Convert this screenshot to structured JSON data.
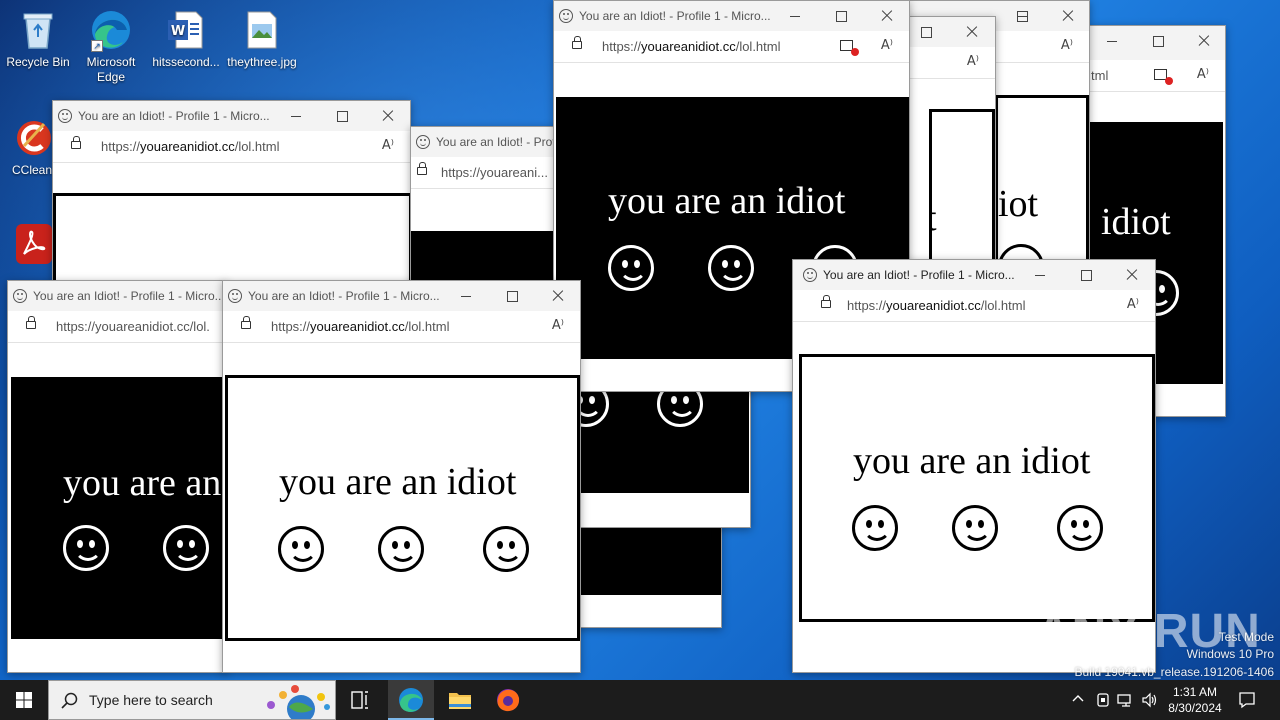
{
  "desktop": {
    "icons": [
      {
        "label": "Recycle Bin",
        "icon": "recycle-bin-icon"
      },
      {
        "label": "Microsoft Edge",
        "icon": "edge-icon"
      },
      {
        "label": "hitssecond...",
        "icon": "word-document-icon"
      },
      {
        "label": "theythree.jpg",
        "icon": "image-file-icon"
      },
      {
        "label": "CClean",
        "icon": "ccleaner-icon"
      },
      {
        "label": "",
        "icon": "acrobat-icon"
      }
    ]
  },
  "browser": {
    "title": "You are an Idiot! - Profile 1 - Micro...",
    "title_short": "You are an Idiot! - Profile",
    "url_prefix": "https://",
    "url_host": "youareanidiot.cc",
    "url_path": "/lol.html",
    "url_full": "https://youareanidiot.cc/lol.html",
    "url_cut_host": "https://youareani...",
    "url_cut_tail": "tml",
    "url_cut_lol": "https://youareanidiot.cc/lol.",
    "read_aloud": "A⁾",
    "message": "you are an idiot",
    "message_cut_left": "you are an",
    "message_frag_t": "t",
    "message_frag_iot": "iot",
    "message_frag_idiot": "idiot"
  },
  "taskbar": {
    "search_placeholder": "Type here to search",
    "time": "1:31 AM",
    "date": "8/30/2024",
    "pinned": [
      "task-view-icon",
      "edge-icon",
      "file-explorer-icon",
      "firefox-icon"
    ]
  },
  "watermark": {
    "brand": "ANY RUN",
    "line1": "Test Mode",
    "line2": "Windows 10 Pro",
    "line3": "Build 19041.vb_release.191206-1406"
  },
  "colors": {
    "desktop": "#1166c9",
    "taskbar": "#1c1c1c",
    "titlebar": "#f3f3f3",
    "panel_black": "#000000",
    "panel_white": "#ffffff"
  }
}
